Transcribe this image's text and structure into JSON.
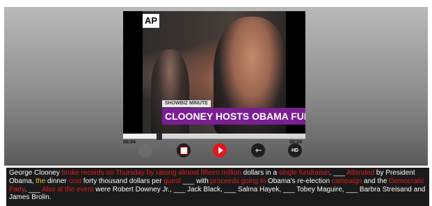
{
  "video": {
    "logo": "AP",
    "segment_tag": "SHOWBIZ MINUTE",
    "headline": "CLOONEY HOSTS OBAMA FUNDR",
    "progress": 0.2,
    "time_elapsed": "00:04",
    "time_total": "00:24"
  },
  "controls": [
    {
      "name": "record-button-icon",
      "label": ""
    },
    {
      "name": "video-icon",
      "label": ""
    },
    {
      "name": "play-icon",
      "label": ""
    },
    {
      "name": "plus-minus-icon",
      "label": "+−"
    },
    {
      "name": "hd-icon",
      "label": "HD"
    }
  ],
  "colors": {
    "highlight_red": "#e21b1b",
    "highlight_yellow": "#f3c31a",
    "purple_banner": "#7a1f93"
  },
  "caption": {
    "segments": [
      {
        "text": "George Clooney ",
        "style": "n"
      },
      {
        "text": "broke records on Thursday by raising almost fifteen million",
        "style": "r"
      },
      {
        "text": " dollars in a ",
        "style": "n"
      },
      {
        "text": "single fundraiser",
        "style": "r"
      },
      {
        "text": ". ___ ",
        "style": "n"
      },
      {
        "text": "Attended",
        "style": "r"
      },
      {
        "text": " by President Obama, ",
        "style": "n"
      },
      {
        "text": "the",
        "style": "y"
      },
      {
        "text": " dinner ",
        "style": "n"
      },
      {
        "text": "cost",
        "style": "r"
      },
      {
        "text": " forty thousand dollars per ",
        "style": "n"
      },
      {
        "text": "guest",
        "style": "r"
      },
      {
        "text": " ___ with ",
        "style": "n"
      },
      {
        "text": "proceeds going to",
        "style": "r"
      },
      {
        "text": " Obama's re-election ",
        "style": "n"
      },
      {
        "text": "campaign",
        "style": "r"
      },
      {
        "text": " and the ",
        "style": "n"
      },
      {
        "text": "Democratic Party",
        "style": "r"
      },
      {
        "text": ". ___ ",
        "style": "n"
      },
      {
        "text": "Also at the event",
        "style": "r"
      },
      {
        "text": " were Robert Downey Jr., ___ Jack Black, ___ Salma Hayek, ___ Tobey Maguire, ___ Barbra Streisand and James Brolin.",
        "style": "n"
      }
    ]
  }
}
